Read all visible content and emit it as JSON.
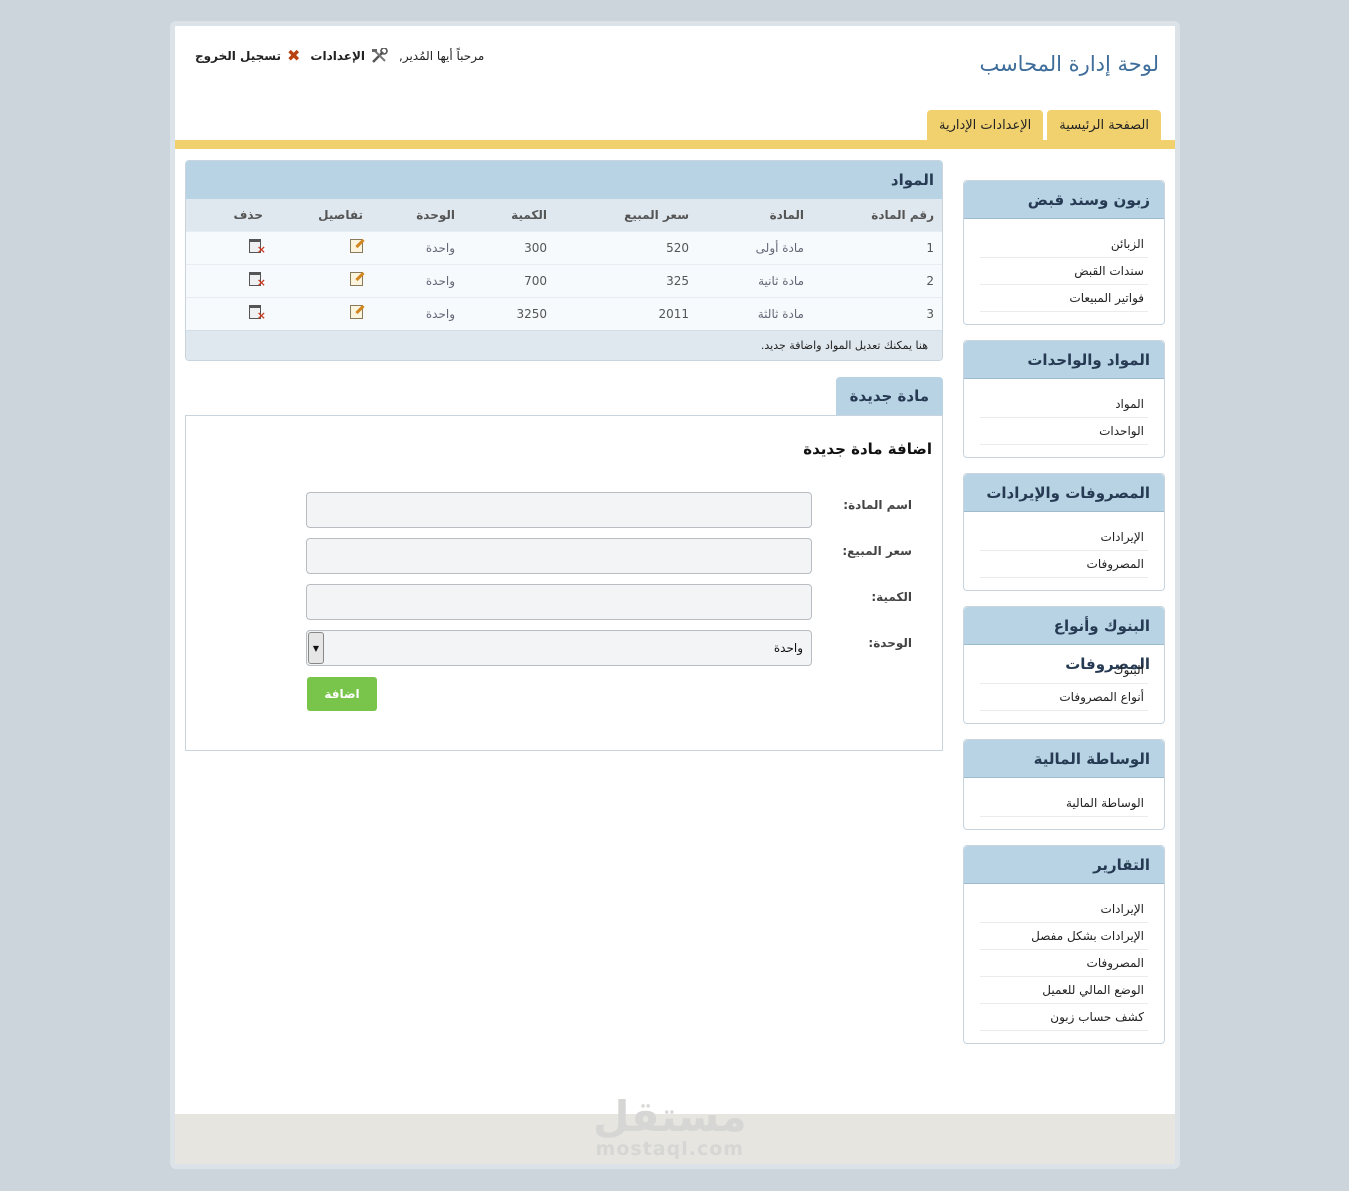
{
  "header": {
    "app_title": "لوحة إدارة المحاسب",
    "welcome": "مرحباً أيها المُدير,",
    "settings_label": "الإعدادات",
    "logout_label": "تسجيل الخروج"
  },
  "tabs": [
    {
      "label": "الصفحة الرئيسية"
    },
    {
      "label": "الإعدادات الإدارية"
    }
  ],
  "sidebar": {
    "boxes": [
      {
        "title": "زبون وسند قبض",
        "items": [
          "الزبائن",
          "سندات القبض",
          "فواتير المبيعات"
        ]
      },
      {
        "title": "المواد والواحدات",
        "items": [
          "المواد",
          "الواحدات"
        ]
      },
      {
        "title": "المصروفات والإيرادات",
        "items": [
          "الإيرادات",
          "المصروفات"
        ]
      },
      {
        "title": "البنوك وأنواع المصروفات",
        "items": [
          "البنوك",
          "أنواع المصروفات"
        ]
      },
      {
        "title": "الوساطة المالية",
        "items": [
          "الوساطة المالية"
        ]
      },
      {
        "title": "التقارير",
        "items": [
          "الإيرادات",
          "الإيرادات بشكل مفصل",
          "المصروفات",
          "الوضع المالي للعميل",
          "كشف حساب زبون"
        ]
      }
    ]
  },
  "materials": {
    "title": "المواد",
    "columns": [
      "رقم المادة",
      "المادة",
      "سعر المبيع",
      "الكمية",
      "الوحدة",
      "تفاصيل",
      "حذف"
    ],
    "rows": [
      {
        "id": "1",
        "name": "مادة أولى",
        "price": "520",
        "qty": "300",
        "unit": "واحدة"
      },
      {
        "id": "2",
        "name": "مادة ثانية",
        "price": "325",
        "qty": "700",
        "unit": "واحدة"
      },
      {
        "id": "3",
        "name": "مادة ثالثة",
        "price": "2011",
        "qty": "3250",
        "unit": "واحدة"
      }
    ],
    "footer_note": "هنا يمكنك تعديل المواد واضافة جديد."
  },
  "new_material": {
    "tab_label": "مادة جديدة",
    "form_title": "اضافة مادة جديدة",
    "name_label": "اسم المادة:",
    "price_label": "سعر المبيع:",
    "qty_label": "الكمية:",
    "unit_label": "الوحدة:",
    "unit_value": "واحدة",
    "submit_label": "اضافة"
  },
  "watermark": {
    "arabic": "مستقل",
    "latin": "mostaql.com"
  },
  "colors": {
    "accent_yellow": "#f1d16e",
    "header_blue": "#b8d3e3",
    "button_green": "#79c54c",
    "title_blue": "#3e6d9a"
  }
}
